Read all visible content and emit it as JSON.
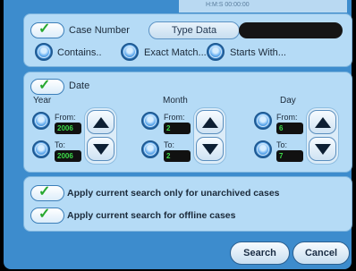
{
  "header_strip": {
    "text": "H:M:S 00:00:00"
  },
  "case_panel": {
    "case_number_toggle": {
      "checked": true,
      "label": "Case Number"
    },
    "type_data_button": "Type Data",
    "type_data_value": "",
    "match_options": [
      "Contains..",
      "Exact Match...",
      "Starts With..."
    ]
  },
  "date_panel": {
    "toggle": {
      "checked": true,
      "label": "Date"
    },
    "columns": [
      {
        "title": "Year",
        "from_label": "From:",
        "from_value": "2006",
        "to_label": "To:",
        "to_value": "2006"
      },
      {
        "title": "Month",
        "from_label": "From:",
        "from_value": "2",
        "to_label": "To:",
        "to_value": "2"
      },
      {
        "title": "Day",
        "from_label": "From:",
        "from_value": "6",
        "to_label": "To:",
        "to_value": "7"
      }
    ]
  },
  "options_panel": {
    "unarchived": {
      "checked": true,
      "label": "Apply current search only for unarchived cases"
    },
    "offline": {
      "checked": true,
      "label": "Apply current search for offline cases"
    }
  },
  "actions": {
    "search": "Search",
    "cancel": "Cancel"
  },
  "icons": {
    "check": "✓"
  },
  "colors": {
    "accent": "#3d8ccd",
    "panel": "#b5dbf6",
    "value_text": "#3ddc49"
  }
}
